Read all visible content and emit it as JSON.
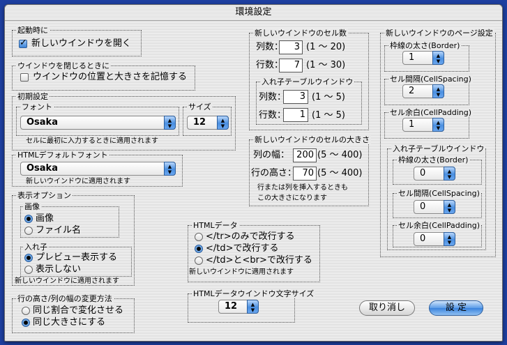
{
  "window": {
    "title": "環境設定"
  },
  "startup": {
    "title": "起動時に",
    "open_new_window": "新しいウインドウを開く"
  },
  "close_window": {
    "title": "ウインドウを閉じるときに",
    "remember_position": "ウインドウの位置と大きさを記憶する"
  },
  "initial": {
    "title": "初期設定",
    "font_group": "フォント",
    "font_value": "Osaka",
    "size_group": "サイズ",
    "size_value": "12",
    "note": "セルに最初に入力するときに適用されます"
  },
  "html_font": {
    "title": "HTMLデフォルトフォント",
    "value": "Osaka",
    "note": "新しいウインドウに適用されます"
  },
  "display": {
    "title": "表示オプション",
    "image_group": "画像",
    "image_opt1": "画像",
    "image_opt2": "ファイル名",
    "nest_group": "入れ子",
    "nest_opt1": "プレビュー表示する",
    "nest_opt2": "表示しない",
    "note": "新しいウインドウに適用されます"
  },
  "row_col": {
    "title": "行の高さ/列の幅の変更方法",
    "opt1": "同じ割合で変化させる",
    "opt2": "同じ大きさにする"
  },
  "cells": {
    "title": "新しいウインドウのセル数",
    "cols_label": "列数：",
    "cols_value": "3",
    "cols_range": "(1 ～ 20)",
    "rows_label": "行数：",
    "rows_value": "7",
    "rows_range": "(1 ～ 30)",
    "nested_title": "入れ子テーブルウインドウ",
    "n_cols_label": "列数：",
    "n_cols_value": "3",
    "n_cols_range": "(1 ～ 5)",
    "n_rows_label": "行数：",
    "n_rows_value": "1",
    "n_rows_range": "(1 ～ 5)"
  },
  "cell_size": {
    "title": "新しいウインドウのセルの大きさ",
    "width_label": "列の幅：",
    "width_value": "200",
    "width_range": "(5 ～ 400)",
    "height_label": "行の高さ：",
    "height_value": "70",
    "height_range": "(5 ～ 400)",
    "note1": "行または列を挿入するときも",
    "note2": "この大きさになります"
  },
  "html_data": {
    "title": "HTMLデータ",
    "opt1": "</tr>のみで改行する",
    "opt2": "</td>で改行する",
    "opt3": "</td>と<br>で改行する",
    "note": "新しいウインドウに適用されます"
  },
  "html_data_font": {
    "title": "HTMLデータウインドウ文字サイズ",
    "value": "12"
  },
  "page": {
    "title": "新しいウインドウのページ設定",
    "border_title": "枠線の太さ(Border)",
    "border_value": "1",
    "spacing_title": "セル間隔(CellSpacing)",
    "spacing_value": "2",
    "padding_title": "セル余白(CellPadding)",
    "padding_value": "1",
    "nested_title": "入れ子テーブルウインドウ",
    "n_border_title": "枠線の太さ(Border)",
    "n_border_value": "0",
    "n_spacing_title": "セル間隔(CellSpacing)",
    "n_spacing_value": "0",
    "n_padding_title": "セル余白(CellPadding)",
    "n_padding_value": "0"
  },
  "buttons": {
    "cancel": "取り消し",
    "ok": "設 定"
  },
  "icons": {
    "popup_arrows": "up-down-arrows-icon",
    "check": "checkmark-icon"
  }
}
